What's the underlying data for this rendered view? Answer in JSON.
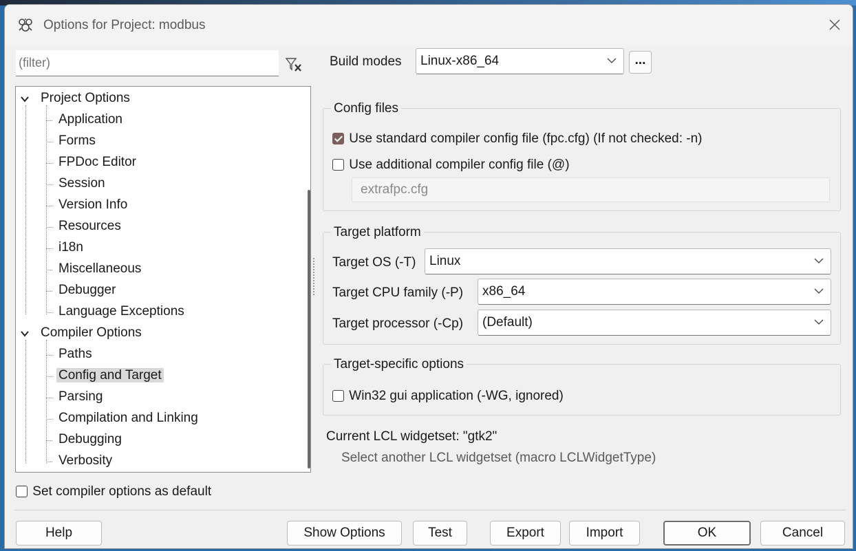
{
  "window": {
    "title": "Options for Project: modbus"
  },
  "filter": {
    "placeholder": "(filter)"
  },
  "tree": {
    "items": [
      {
        "label": "Project Options",
        "level": 0,
        "expanded": true
      },
      {
        "label": "Application",
        "level": 1
      },
      {
        "label": "Forms",
        "level": 1
      },
      {
        "label": "FPDoc Editor",
        "level": 1
      },
      {
        "label": "Session",
        "level": 1
      },
      {
        "label": "Version Info",
        "level": 1
      },
      {
        "label": "Resources",
        "level": 1
      },
      {
        "label": "i18n",
        "level": 1
      },
      {
        "label": "Miscellaneous",
        "level": 1
      },
      {
        "label": "Debugger",
        "level": 1
      },
      {
        "label": "Language Exceptions",
        "level": 1
      },
      {
        "label": "Compiler Options",
        "level": 0,
        "expanded": true
      },
      {
        "label": "Paths",
        "level": 1
      },
      {
        "label": "Config and Target",
        "level": 1,
        "selected": true
      },
      {
        "label": "Parsing",
        "level": 1
      },
      {
        "label": "Compilation and Linking",
        "level": 1
      },
      {
        "label": "Debugging",
        "level": 1
      },
      {
        "label": "Verbosity",
        "level": 1
      }
    ]
  },
  "set_default": {
    "label": "Set compiler options as default",
    "checked": false
  },
  "build_modes": {
    "label": "Build modes",
    "value": "Linux-x86_64",
    "more_label": "..."
  },
  "config_files": {
    "title": "Config files",
    "use_standard": {
      "label": "Use standard compiler config file (fpc.cfg) (If not checked: -n)",
      "checked": true
    },
    "use_additional": {
      "label": "Use additional compiler config file (@)",
      "checked": false
    },
    "additional_file": "extrafpc.cfg"
  },
  "target_platform": {
    "title": "Target platform",
    "os_label": "Target OS (-T)",
    "os_value": "Linux",
    "cpu_label": "Target CPU family (-P)",
    "cpu_value": "x86_64",
    "proc_label": "Target processor (-Cp)",
    "proc_value": "(Default)"
  },
  "target_specific": {
    "title": "Target-specific options",
    "win32_gui": {
      "label": "Win32 gui application (-WG, ignored)",
      "checked": false
    }
  },
  "lcl": {
    "current": "Current LCL widgetset: \"gtk2\"",
    "select_link": "Select another LCL widgetset (macro LCLWidgetType)"
  },
  "buttons": {
    "help": "Help",
    "show_options": "Show Options",
    "test": "Test",
    "export": "Export",
    "import": "Import",
    "ok": "OK",
    "cancel": "Cancel"
  },
  "colors": {
    "checked_accent": "#7c5e5e",
    "selection": "#d9d9d9"
  }
}
